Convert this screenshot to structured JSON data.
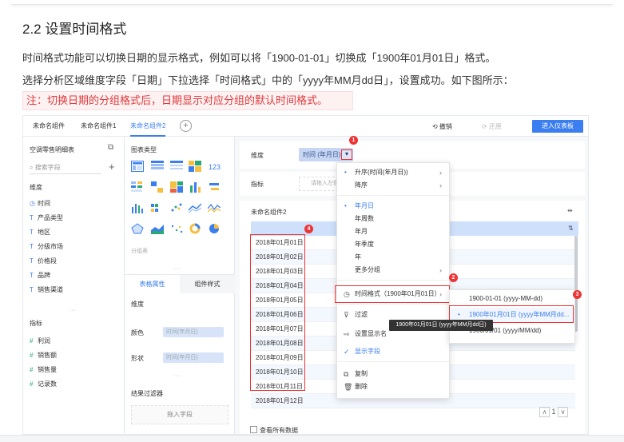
{
  "doc": {
    "heading": "2.2 设置时间格式",
    "para1": "时间格式功能可以切换日期的显示格式，例如可以将「1900-01-01」切换成「1900年01月01日」格式。",
    "para2": "选择分析区域维度字段「日期」下拉选择「时间格式」中的「yyyy年MM月dd日」，设置成功。如下图所示：",
    "note": "注：切换日期的分组格式后，日期显示对应分组的默认时间格式。"
  },
  "app": {
    "tabs": [
      "未命名组件",
      "未命名组件1",
      "未命名组件2"
    ],
    "add_tab": "+",
    "undo": "⟲ 撤销",
    "redo": "⟳ 还原",
    "enter_dashboard": "进入仪表板",
    "left": {
      "title": "空调零售明细表",
      "search_placeholder": "搜索字段",
      "dim_section": "维度",
      "dims": [
        {
          "icon": "clock-icon",
          "glyph": "◷",
          "label": "时间"
        },
        {
          "icon": "text-field-icon",
          "glyph": "T",
          "label": "产品类型"
        },
        {
          "icon": "text-field-icon",
          "glyph": "T",
          "label": "地区"
        },
        {
          "icon": "text-field-icon",
          "glyph": "T",
          "label": "分级市场"
        },
        {
          "icon": "text-field-icon",
          "glyph": "T",
          "label": "价格段"
        },
        {
          "icon": "text-field-icon",
          "glyph": "T",
          "label": "品牌"
        },
        {
          "icon": "text-field-icon",
          "glyph": "T",
          "label": "销售渠道"
        }
      ],
      "metric_section": "指标",
      "metrics": [
        {
          "glyph": "#",
          "label": "利润"
        },
        {
          "glyph": "#",
          "label": "销售额"
        },
        {
          "glyph": "#",
          "label": "销售量"
        },
        {
          "glyph": "#",
          "label": "记录数"
        }
      ]
    },
    "middle": {
      "chart_type_title": "图表类型",
      "group_label": "分组表",
      "tab_table": "表格属性",
      "tab_component": "组件样式",
      "dim_label": "维度",
      "color_label": "颜色",
      "color_value": "时间(年月日)",
      "shape_label": "形状",
      "shape_value": "时间(年月日)",
      "filter_title": "结果过滤器",
      "drop_field": "拖入字段"
    },
    "main": {
      "dim_label": "维度",
      "dim_pill": "时间 (年月日)",
      "metric_label": "指标",
      "metric_drop": "请拖入左侧",
      "table_title": "未命名组件2",
      "rows": [
        "2018年01月01日",
        "2018年01月02日",
        "2018年01月03日",
        "2018年01月04日",
        "2018年01月05日",
        "2018年01月06日",
        "2018年01月07日",
        "2018年01月08日",
        "2018年01月09日",
        "2018年01月10日",
        "2018年01月11日",
        "2018年01月12日"
      ],
      "page": "1",
      "show_all": "查看所有数据"
    },
    "menu": {
      "asc": "升序(时间(年月日))",
      "desc": "降序",
      "g1": "年月日",
      "g2": "年周数",
      "g3": "年月",
      "g4": "年季度",
      "g5": "年",
      "more": "更多分组",
      "time_format": "时间格式（1900年01月01日）",
      "filter": "过滤",
      "display_name": "设置显示名",
      "show_field": "显示字段",
      "copy": "复制",
      "delete": "删除"
    },
    "submenu": {
      "opt1": "1900-01-01 (yyyy-MM-dd)",
      "opt2": "1900年01月01日 (yyyy年MM月dd...",
      "opt3": "1900/01/01 (yyyy/MM/dd)"
    },
    "tooltip": "1900年01月01日 (yyyy年MM月dd日)",
    "badges": [
      "1",
      "2",
      "3",
      "4"
    ],
    "colors": {
      "accent": "#3b7ef0",
      "annotation": "#e33333"
    }
  }
}
